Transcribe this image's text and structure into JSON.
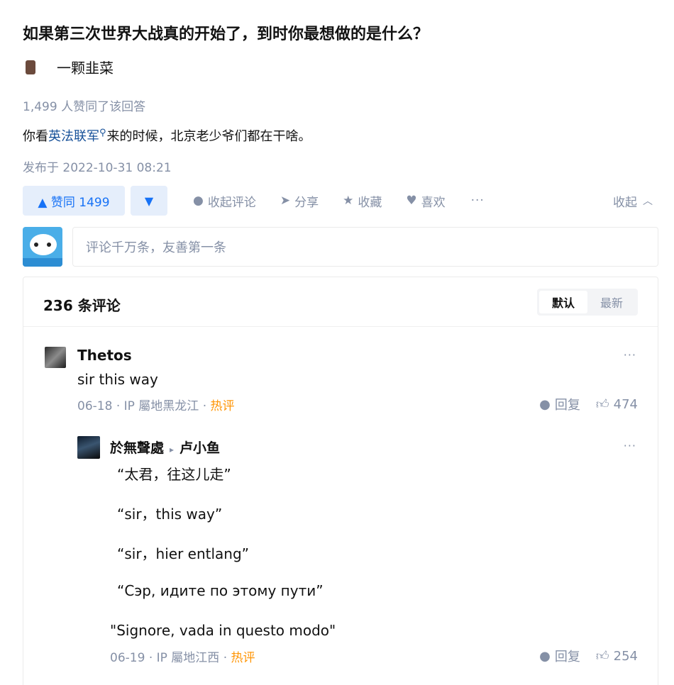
{
  "question": {
    "title": "如果第三次世界大战真的开始了，到时你最想做的是什么？"
  },
  "answer": {
    "author": "一颗韭菜",
    "votes_text": "1,499 人赞同了该回答",
    "content_before": "你看",
    "content_link": "英法联军",
    "content_after": "来的时候，北京老少爷们都在干啥。",
    "published": "发布于 2022-10-31 08:21"
  },
  "actions": {
    "upvote": "▲ 赞同 1499",
    "downvote": "▼",
    "collapse_comments": "收起评论",
    "share": "分享",
    "favorite": "收藏",
    "like": "喜欢",
    "more": "···",
    "collapse": "收起"
  },
  "comment_box": {
    "placeholder": "评论千万条，友善第一条"
  },
  "comments": {
    "count_label": "236 条评论",
    "sort_default": "默认",
    "sort_latest": "最新",
    "items": [
      {
        "author": "Thetos",
        "text": "sir this way",
        "date": "06-18",
        "ip": "IP 屬地黑龙江",
        "tag": "热评",
        "reply": "回复",
        "likes": "474"
      },
      {
        "author": "於無聲處",
        "reply_to": "卢小鱼",
        "lines": [
          "“太君，往这儿走”",
          "“sir，this way”",
          "“sir，hier entlang”",
          "“Сэр, идите по этому пути”",
          "\"Signore, vada in questo modo\""
        ],
        "date": "06-19",
        "ip": "IP 屬地江西",
        "tag": "热评",
        "reply": "回复",
        "likes": "254"
      }
    ]
  },
  "icons": {
    "upvote": "triangle-up-icon",
    "downvote": "triangle-down-icon",
    "comment": "comment-bubble-icon",
    "share": "paper-plane-icon",
    "favorite": "star-icon",
    "like": "heart-icon",
    "chevron": "chevron-up-icon",
    "thumb": "thumbs-up-icon"
  },
  "colors": {
    "accent": "#1772f6",
    "accent_bg": "#e5eefb",
    "muted": "#8590a6",
    "hot": "#ff9607",
    "link": "#175199"
  }
}
